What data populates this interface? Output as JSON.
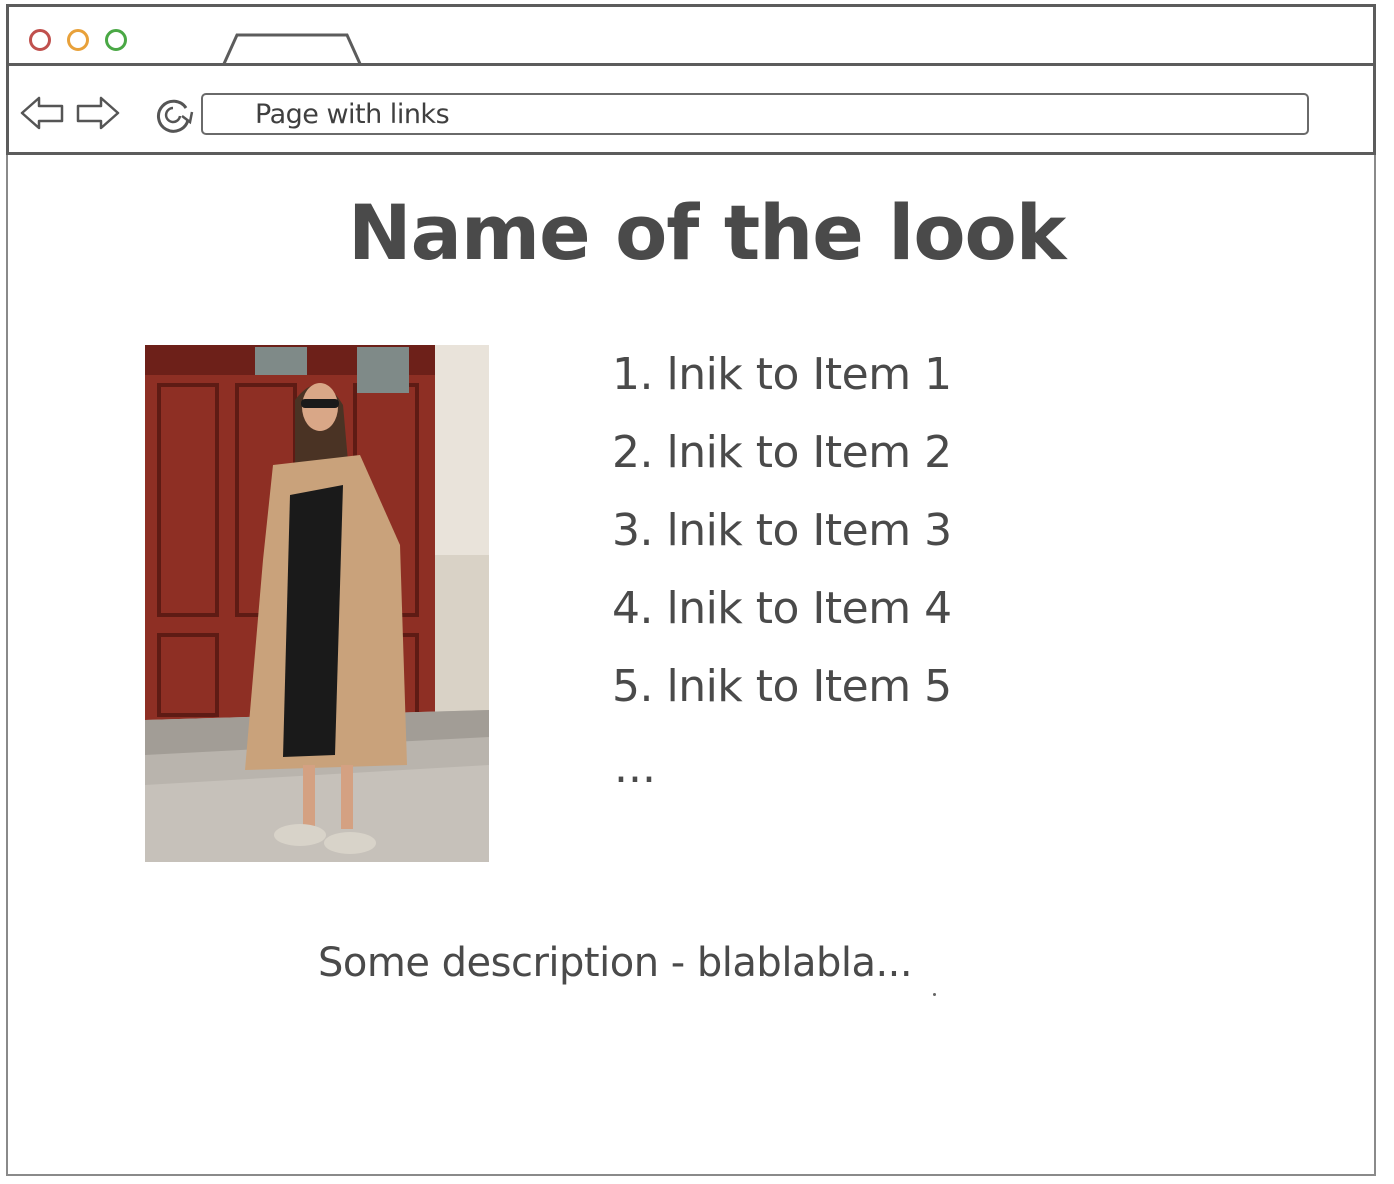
{
  "browser": {
    "address_text": "Page with links"
  },
  "page": {
    "title": "Name of the look",
    "image_alt": "look photo",
    "links": [
      "1. lnik to Item 1",
      "2. lnik to Item 2",
      "3. lnik to Item 3",
      "4. lnik to Item 4",
      "5. lnik to Item 5"
    ],
    "more": "...",
    "description": "Some description - blablabla..."
  },
  "colors": {
    "close": "#c0504d",
    "minimize": "#e8a13a",
    "maximize": "#4aa845",
    "ink": "#4a4a4a"
  }
}
